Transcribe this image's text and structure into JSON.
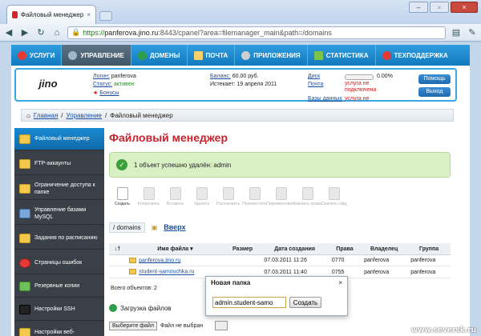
{
  "browser": {
    "tab_title": "Файловый менеджер",
    "url_scheme": "https://",
    "url_host": "panferova.jino.ru",
    "url_path": ":8443/cpanel?area=filemanager_main&path=/domains"
  },
  "topnav": [
    "УСЛУГИ",
    "УПРАВЛЕНИЕ",
    "ДОМЕНЫ",
    "ПОЧТА",
    "ПРИЛОЖЕНИЯ",
    "СТАТИСТИКА",
    "ТЕХПОДДЕРЖКА"
  ],
  "info": {
    "logo": "jino",
    "login_label": "Логин:",
    "login": "panferova",
    "status_label": "Статус:",
    "status": "активен",
    "bonus": "Бонусы",
    "balance_label": "Баланс:",
    "balance": "60.00 руб.",
    "expires_label": "Истекает:",
    "expires": "19 апреля 2011",
    "disk_label": "Диск",
    "disk_pct": "0.00%",
    "mail_label": "Почта",
    "mail_status": "услуга не подключена",
    "db_label": "Базы данных",
    "db_status": "услуга не",
    "help_btn": "Помощь",
    "exit_btn": "Выход"
  },
  "breadcrumb": {
    "home": "Главная",
    "sep": "/",
    "mgmt": "Управление",
    "current": "Файловый менеджер"
  },
  "sidebar": [
    "Файловый менеджер",
    "FTP-аккаунты",
    "Ограничение доступа к папке",
    "Управление базами MySQL",
    "Задания по расписанию",
    "Страницы ошибок",
    "Резервные копии",
    "Настройки SSH",
    "Настройки веб-"
  ],
  "heading": "Файловый менеджер",
  "success_msg": "1 объект успешно удалён: admin",
  "toolbar": [
    "Создать",
    "Копировать",
    "Вставить",
    "Удалить",
    "Распаковать",
    "Переместить",
    "Переименовать",
    "Сменить права",
    "Сменить гайд"
  ],
  "path": {
    "current": "/ domains",
    "up": "Вверх"
  },
  "table": {
    "headers": [
      "↓†",
      "Имя файла ▾",
      "Размер",
      "Дата создания",
      "Права",
      "Владелец",
      "Группа"
    ],
    "rows": [
      {
        "name": "panferova.jino.ru",
        "size": "",
        "date": "07.03.2011 11:26",
        "perm": "0770",
        "owner": "panferova",
        "group": "panferova"
      },
      {
        "name": "student-samouchka.ru",
        "size": "",
        "date": "07.03.2011 11:40",
        "perm": "0755",
        "owner": "panferova",
        "group": "panferova"
      }
    ]
  },
  "total": "Всего объектов: 2",
  "upload": {
    "title": "Загрузка файлов",
    "choose": "Выберите файл",
    "none": "Файл не выбран"
  },
  "dialog": {
    "title": "Новая папка",
    "close": "×",
    "value": "admin.student-samo",
    "create": "Создать"
  },
  "watermark": "www.seversk.ru"
}
